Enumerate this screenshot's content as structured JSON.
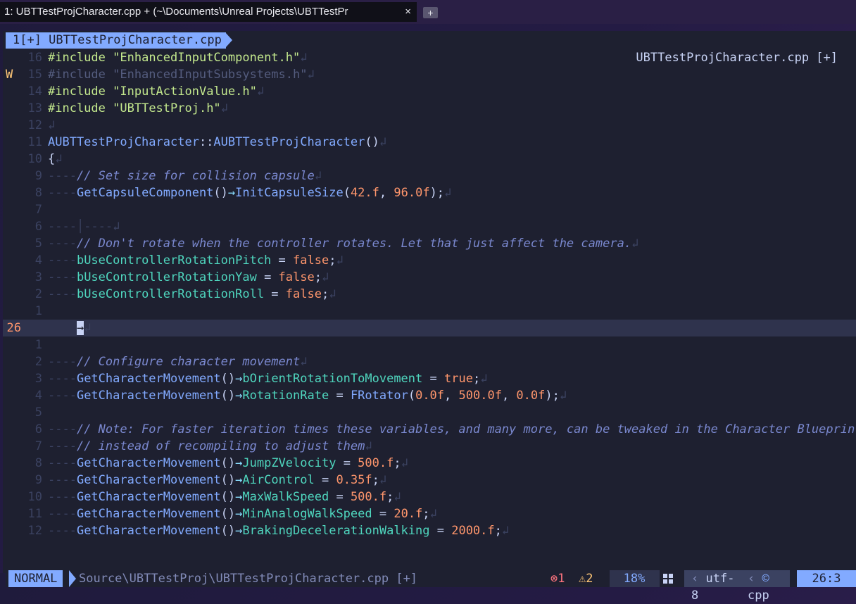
{
  "window": {
    "tab_title": "1: UBTTestProjCharacter.cpp + (~\\Documents\\Unreal Projects\\UBTTestPr",
    "close_glyph": "×",
    "new_tab_glyph": "+"
  },
  "editor": {
    "buffer_tab": "1[+] UBTTestProjCharacter.cpp",
    "winbar": "UBTTestProjCharacter.cpp [+]",
    "cursor_line_number": "26",
    "lines": [
      {
        "n": "16",
        "sign": "",
        "text": "#include \"EnhancedInputComponent.h\"↲"
      },
      {
        "n": "15",
        "sign": "W",
        "text": "#include \"EnhancedInputSubsystems.h\"↲"
      },
      {
        "n": "14",
        "sign": "",
        "text": "#include \"InputActionValue.h\"↲"
      },
      {
        "n": "13",
        "sign": "",
        "text": "#include \"UBTTestProj.h\"↲"
      },
      {
        "n": "12",
        "sign": "",
        "text": "↲"
      },
      {
        "n": "11",
        "sign": "",
        "text": "AUBTTestProjCharacter::AUBTTestProjCharacter()↲"
      },
      {
        "n": "10",
        "sign": "",
        "text": "{↲"
      },
      {
        "n": "9",
        "sign": "",
        "text": "// Set size for collision capsule↲"
      },
      {
        "n": "8",
        "sign": "",
        "text": "GetCapsuleComponent()→InitCapsuleSize(42.f, 96.0f);↲"
      },
      {
        "n": "7",
        "sign": "",
        "text": ""
      },
      {
        "n": "6",
        "sign": "",
        "text": "↲"
      },
      {
        "n": "5",
        "sign": "",
        "text": "// Don't rotate when the controller rotates. Let that just affect the camera.↲"
      },
      {
        "n": "4",
        "sign": "",
        "text": "bUseControllerRotationPitch = false;↲"
      },
      {
        "n": "3",
        "sign": "",
        "text": "bUseControllerRotationYaw = false;↲"
      },
      {
        "n": "2",
        "sign": "",
        "text": "bUseControllerRotationRoll = false;↲"
      },
      {
        "n": "1",
        "sign": "",
        "text": ""
      },
      {
        "n": "26",
        "sign": "",
        "text": "↲"
      },
      {
        "n": "1",
        "sign": "",
        "text": ""
      },
      {
        "n": "2",
        "sign": "",
        "text": "// Configure character movement↲"
      },
      {
        "n": "3",
        "sign": "",
        "text": "GetCharacterMovement()→bOrientRotationToMovement = true;↲"
      },
      {
        "n": "4",
        "sign": "",
        "text": "GetCharacterMovement()→RotationRate = FRotator(0.0f, 500.0f, 0.0f);↲"
      },
      {
        "n": "5",
        "sign": "",
        "text": ""
      },
      {
        "n": "6",
        "sign": "",
        "text": "// Note: For faster iteration times these variables, and many more, can be tweaked in the Character Blueprint"
      },
      {
        "n": "7",
        "sign": "",
        "text": "// instead of recompiling to adjust them↲"
      },
      {
        "n": "8",
        "sign": "",
        "text": "GetCharacterMovement()→JumpZVelocity = 500.f;↲"
      },
      {
        "n": "9",
        "sign": "",
        "text": "GetCharacterMovement()→AirControl = 0.35f;↲"
      },
      {
        "n": "10",
        "sign": "",
        "text": "GetCharacterMovement()→MaxWalkSpeed = 500.f;↲"
      },
      {
        "n": "11",
        "sign": "",
        "text": "GetCharacterMovement()→MinAnalogWalkSpeed = 20.f;↲"
      },
      {
        "n": "12",
        "sign": "",
        "text": "GetCharacterMovement()→BrakingDecelerationWalking = 2000.f;↲"
      }
    ]
  },
  "statusline": {
    "mode": "NORMAL",
    "path": "Source\\UBTTestProj\\UBTTestProjCharacter.cpp [+]",
    "errors": "⊗1",
    "warnings": "⚠2",
    "percent": "18%",
    "os_icon": "windows-icon",
    "encoding": "utf-8",
    "filetype": "cpp",
    "filetype_icon": "cpp-icon",
    "position": "26:3"
  },
  "colors": {
    "accent": "#82aaff",
    "warning": "#ffc777",
    "error": "#ff757f",
    "number": "#ff966c",
    "string": "#c3e88d"
  }
}
